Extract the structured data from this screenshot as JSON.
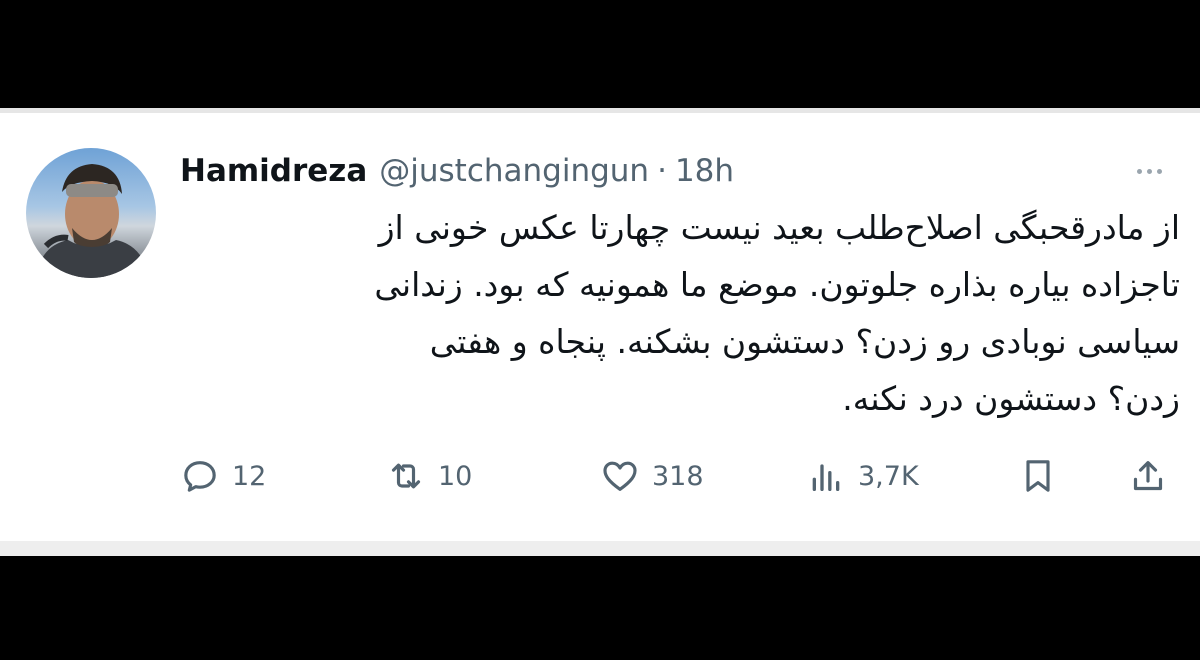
{
  "tweet": {
    "display_name": "Hamidreza",
    "handle": "@justchangingun",
    "separator": "·",
    "time": "18h",
    "text_lines": [
      "از مادرقحبگی اصلاح‌طلب بعید نیست چهارتا عکس خونی از",
      "تاجزاده بیاره بذاره جلوتون. موضع ما همونیه که بود. زندانی",
      "سیاسی نوبادی رو زدن؟ دستشون بشکنه. پنجاه و هفتی",
      "زدن؟ دستشون درد نکنه."
    ],
    "actions": {
      "replies": "12",
      "retweets": "10",
      "likes": "318",
      "views": "3,7K"
    }
  },
  "icons": {
    "avatar": "profile-photo",
    "more": "more-dots-icon",
    "reply": "reply-icon",
    "retweet": "retweet-icon",
    "like": "heart-icon",
    "views": "views-icon",
    "bookmark": "bookmark-icon",
    "share": "share-icon"
  },
  "colors": {
    "text": "#0f1419",
    "secondary": "#536471",
    "background": "#ffffff",
    "frame": "#000000"
  }
}
